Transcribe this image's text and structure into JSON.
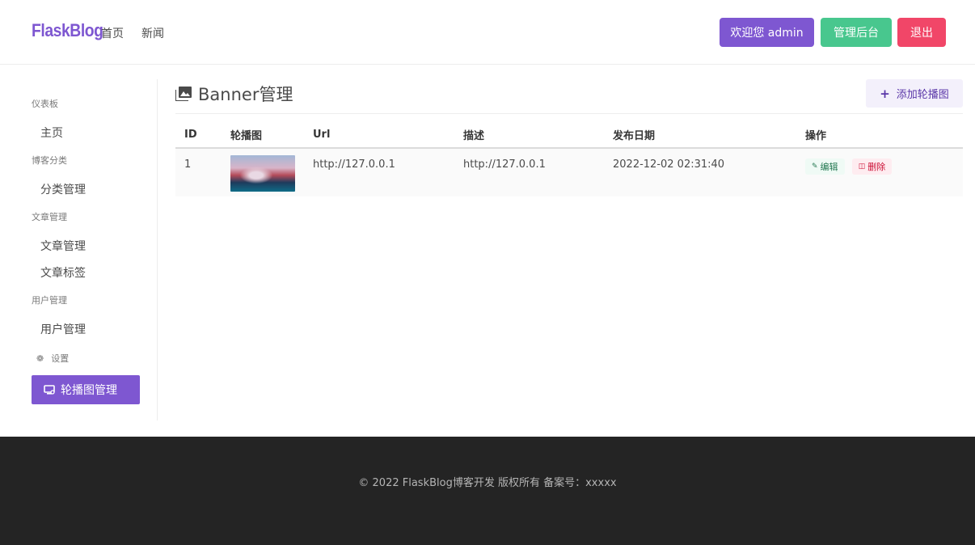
{
  "navbar": {
    "brand": "FlaskBlog",
    "links": [
      "首页",
      "新闻"
    ],
    "welcome": "欢迎您 admin",
    "admin": "管理后台",
    "logout": "退出"
  },
  "sidebar": {
    "dashboard_label": "仪表板",
    "home": "主页",
    "category_label": "博客分类",
    "category_manage": "分类管理",
    "article_label": "文章管理",
    "article_manage": "文章管理",
    "article_tags": "文章标签",
    "user_label": "用户管理",
    "user_manage": "用户管理",
    "settings": "设置",
    "banner_manage": "轮播图管理"
  },
  "main": {
    "title": "Banner管理",
    "add_button": "添加轮播图",
    "table": {
      "headers": [
        "ID",
        "轮播图",
        "Url",
        "描述",
        "发布日期",
        "操作"
      ],
      "rows": [
        {
          "id": "1",
          "url": "http://127.0.0.1",
          "desc": "http://127.0.0.1",
          "date": "2022-12-02 02:31:40",
          "edit": "编辑",
          "delete": "删除"
        }
      ]
    }
  },
  "footer": {
    "text": "© 2022 FlaskBlog博客开发 版权所有 备案号：xxxxx"
  },
  "colors": {
    "primary": "#7e57d1",
    "success": "#48c78e",
    "danger": "#f14668",
    "footer_bg": "#242424"
  }
}
